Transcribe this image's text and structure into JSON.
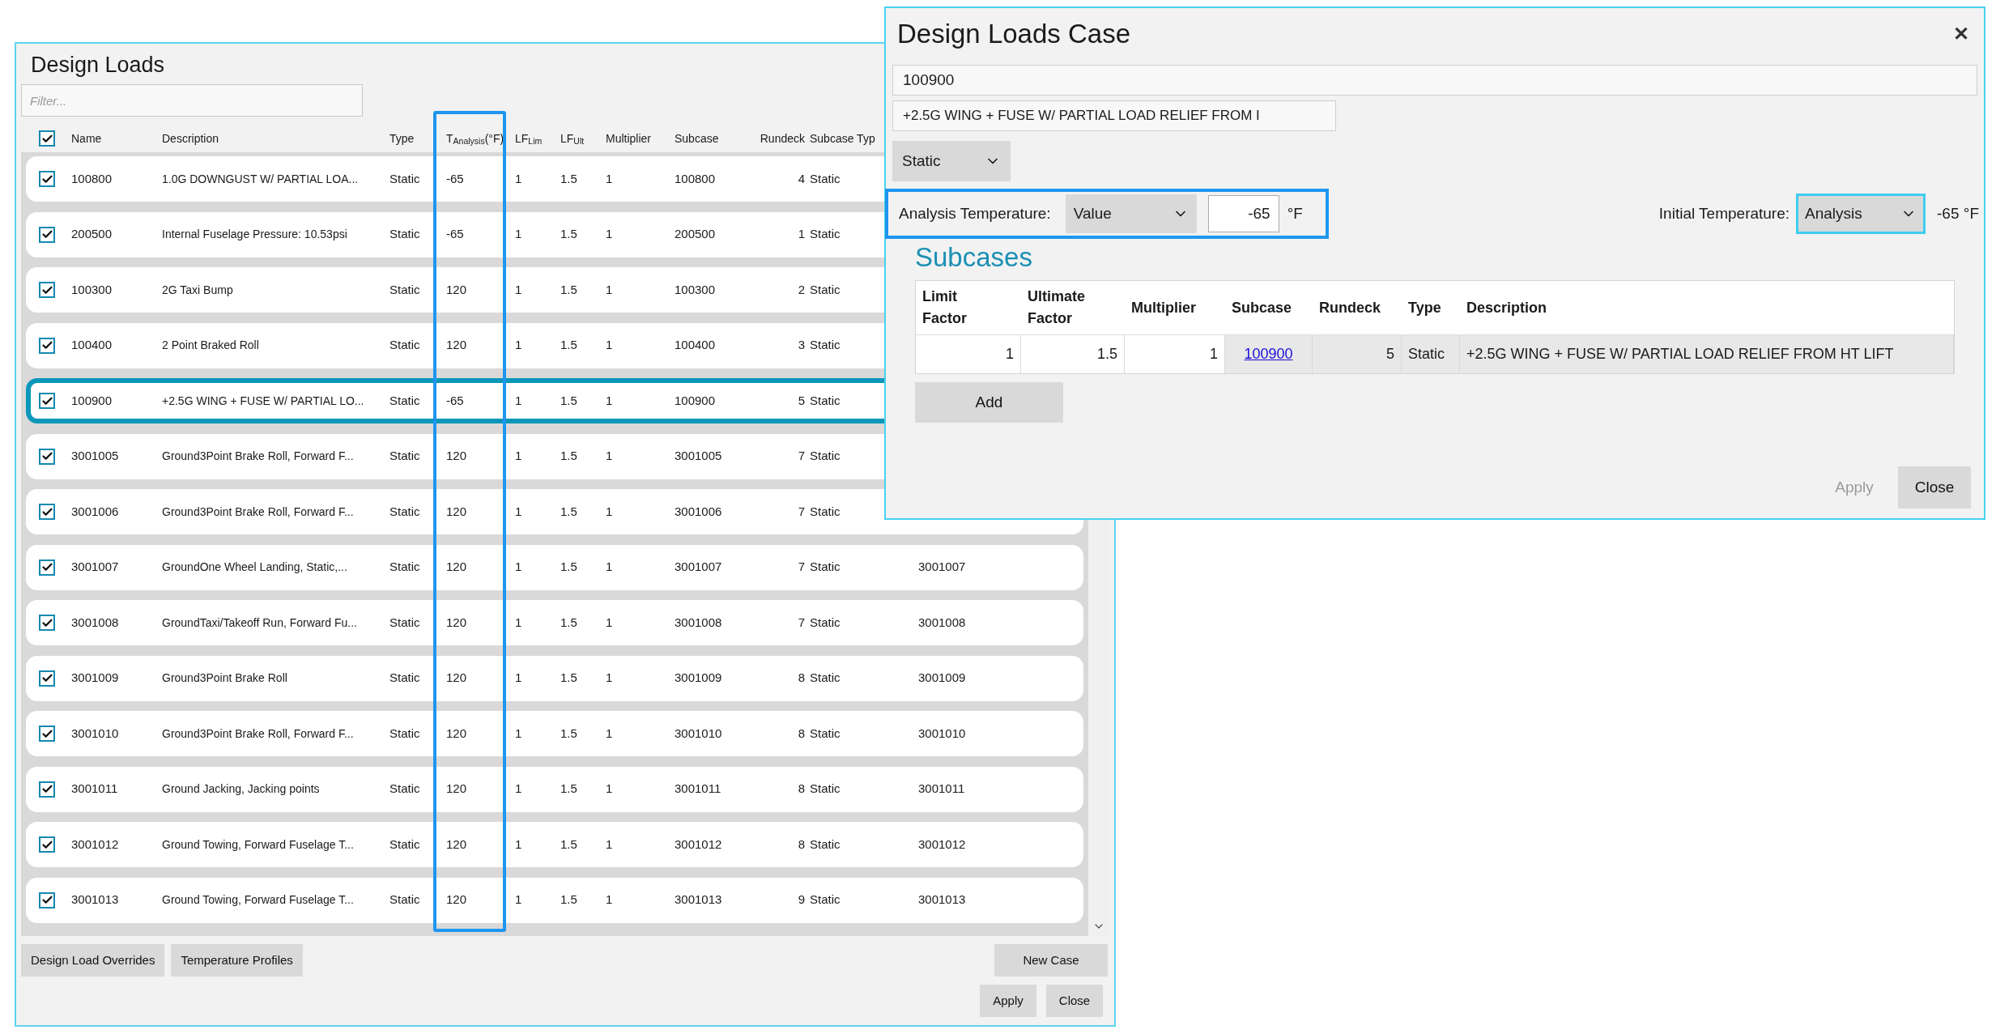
{
  "left_window": {
    "title": "Design Loads",
    "filter": {
      "placeholder": "Filter..."
    },
    "select_all": {
      "checked": true
    },
    "columns": [
      "Name",
      "Description",
      "Type",
      "T$_{Analysis}$(°F)",
      "LF$_{Lim}$",
      "LF$_{Ult}$",
      "Multiplier",
      "Subcase",
      "Rundeck",
      "Subcase Typ"
    ],
    "rows": [
      {
        "checked": true,
        "selected": false,
        "name": "100800",
        "description": "1.0G DOWNGUST W/ PARTIAL LOA...",
        "type": "Static",
        "t_analysis": "-65",
        "lf_lim": "1",
        "lf_ult": "1.5",
        "multiplier": "1",
        "subcase": "100800",
        "rundeck": "4",
        "subcase_type": "Static"
      },
      {
        "checked": true,
        "selected": false,
        "name": "200500",
        "description": "Internal Fuselage Pressure: 10.53psi",
        "type": "Static",
        "t_analysis": "-65",
        "lf_lim": "1",
        "lf_ult": "1.5",
        "multiplier": "1",
        "subcase": "200500",
        "rundeck": "1",
        "subcase_type": "Static"
      },
      {
        "checked": true,
        "selected": false,
        "name": "100300",
        "description": "2G Taxi Bump",
        "type": "Static",
        "t_analysis": "120",
        "lf_lim": "1",
        "lf_ult": "1.5",
        "multiplier": "1",
        "subcase": "100300",
        "rundeck": "2",
        "subcase_type": "Static"
      },
      {
        "checked": true,
        "selected": false,
        "name": "100400",
        "description": "2 Point Braked Roll",
        "type": "Static",
        "t_analysis": "120",
        "lf_lim": "1",
        "lf_ult": "1.5",
        "multiplier": "1",
        "subcase": "100400",
        "rundeck": "3",
        "subcase_type": "Static"
      },
      {
        "checked": true,
        "selected": true,
        "name": "100900",
        "description": "+2.5G WING + FUSE W/ PARTIAL LO...",
        "type": "Static",
        "t_analysis": "-65",
        "lf_lim": "1",
        "lf_ult": "1.5",
        "multiplier": "1",
        "subcase": "100900",
        "rundeck": "5",
        "subcase_type": "Static"
      },
      {
        "checked": true,
        "selected": false,
        "name": "3001005",
        "description": "Ground3Point Brake Roll, Forward F...",
        "type": "Static",
        "t_analysis": "120",
        "lf_lim": "1",
        "lf_ult": "1.5",
        "multiplier": "1",
        "subcase": "3001005",
        "rundeck": "7",
        "subcase_type": "Static"
      },
      {
        "checked": true,
        "selected": false,
        "name": "3001006",
        "description": "Ground3Point Brake Roll, Forward F...",
        "type": "Static",
        "t_analysis": "120",
        "lf_lim": "1",
        "lf_ult": "1.5",
        "multiplier": "1",
        "subcase": "3001006",
        "rundeck": "7",
        "subcase_type": "Static"
      },
      {
        "checked": true,
        "selected": false,
        "name": "3001007",
        "description": "GroundOne Wheel Landing, Static,...",
        "type": "Static",
        "t_analysis": "120",
        "lf_lim": "1",
        "lf_ult": "1.5",
        "multiplier": "1",
        "subcase": "3001007",
        "rundeck": "7",
        "subcase_type": "Static",
        "column_10": "3001007"
      },
      {
        "checked": true,
        "selected": false,
        "name": "3001008",
        "description": "GroundTaxi/Takeoff Run, Forward Fu...",
        "type": "Static",
        "t_analysis": "120",
        "lf_lim": "1",
        "lf_ult": "1.5",
        "multiplier": "1",
        "subcase": "3001008",
        "rundeck": "7",
        "subcase_type": "Static",
        "column_10": "3001008"
      },
      {
        "checked": true,
        "selected": false,
        "name": "3001009",
        "description": "Ground3Point Brake Roll",
        "type": "Static",
        "t_analysis": "120",
        "lf_lim": "1",
        "lf_ult": "1.5",
        "multiplier": "1",
        "subcase": "3001009",
        "rundeck": "8",
        "subcase_type": "Static",
        "column_10": "3001009"
      },
      {
        "checked": true,
        "selected": false,
        "name": "3001010",
        "description": "Ground3Point Brake Roll, Forward F...",
        "type": "Static",
        "t_analysis": "120",
        "lf_lim": "1",
        "lf_ult": "1.5",
        "multiplier": "1",
        "subcase": "3001010",
        "rundeck": "8",
        "subcase_type": "Static",
        "column_10": "3001010"
      },
      {
        "checked": true,
        "selected": false,
        "name": "3001011",
        "description": "Ground Jacking, Jacking points",
        "type": "Static",
        "t_analysis": "120",
        "lf_lim": "1",
        "lf_ult": "1.5",
        "multiplier": "1",
        "subcase": "3001011",
        "rundeck": "8",
        "subcase_type": "Static",
        "column_10": "3001011"
      },
      {
        "checked": true,
        "selected": false,
        "name": "3001012",
        "description": "Ground Towing, Forward Fuselage T...",
        "type": "Static",
        "t_analysis": "120",
        "lf_lim": "1",
        "lf_ult": "1.5",
        "multiplier": "1",
        "subcase": "3001012",
        "rundeck": "8",
        "subcase_type": "Static",
        "column_10": "3001012"
      },
      {
        "checked": true,
        "selected": false,
        "name": "3001013",
        "description": "Ground Towing, Forward Fuselage T...",
        "type": "Static",
        "t_analysis": "120",
        "lf_lim": "1",
        "lf_ult": "1.5",
        "multiplier": "1",
        "subcase": "3001013",
        "rundeck": "9",
        "subcase_type": "Static",
        "column_10": "3001013"
      }
    ],
    "left_buttons": [
      "Design Load Overrides",
      "Temperature Profiles"
    ],
    "new_case_button": "New Case",
    "apply_button": "Apply",
    "close_button": "Close"
  },
  "case_dialog": {
    "title": "Design Loads Case",
    "close_glyph": "✕",
    "name_value": "100900",
    "description_value": "+2.5G WING + FUSE W/ PARTIAL LOAD RELIEF FROM I",
    "type_dropdown": "Static",
    "analysis_temperature": {
      "label": "Analysis Temperature:",
      "mode": "Value",
      "value": "-65",
      "unit": "°F"
    },
    "initial_temperature": {
      "label": "Initial Temperature:",
      "mode": "Analysis",
      "focused": true,
      "reading": "-65 °F"
    },
    "subcases_heading": "Subcases",
    "subcase_columns": [
      "Limit Factor",
      "Ultimate Factor",
      "Multiplier",
      "Subcase",
      "Rundeck",
      "Type",
      "Description"
    ],
    "subcase_rows": [
      {
        "limit_factor": "1",
        "ultimate_factor": "1.5",
        "multiplier": "1",
        "subcase": "100900",
        "rundeck": "5",
        "type": "Static",
        "description": "+2.5G WING + FUSE W/ PARTIAL LOAD RELIEF FROM HT LIFT"
      }
    ],
    "add_button": "Add",
    "apply_button": {
      "label": "Apply",
      "disabled": true
    },
    "close_button": "Close"
  }
}
